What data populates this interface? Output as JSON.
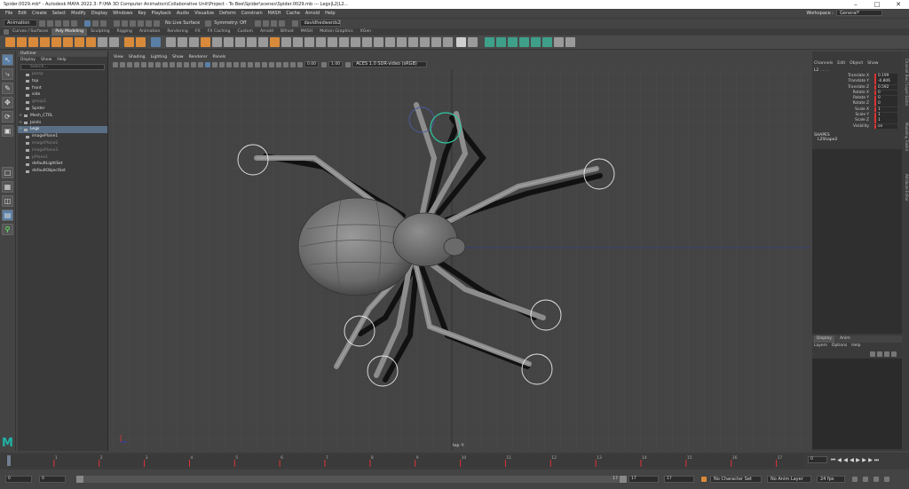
{
  "title_bar": {
    "text": "Spider.0029.mb* - Autodesk MAYA 2022.3: F:\\MA 3D Computer Animation\\Collaborative Unit\\Project - To Bee\\Spider\\scenes\\Spider.0029.mb --- Legs|L2|L2..."
  },
  "menu_bar": {
    "items": [
      "File",
      "Edit",
      "Create",
      "Select",
      "Modify",
      "Display",
      "Windows",
      "Key",
      "Playback",
      "Audio",
      "Visualize",
      "Deform",
      "Constrain",
      "MASH",
      "Cache",
      "Arnold",
      "Help"
    ],
    "workspace_label": "Workspace :",
    "workspace_value": "General*"
  },
  "status_line": {
    "mode": "Animation",
    "live_surface": "No Live Surface",
    "symmetry": "Symmetry: Off",
    "user": "davidhedwards2"
  },
  "shelf": {
    "tabs": [
      "Curves / Surfaces",
      "Poly Modeling",
      "Sculpting",
      "Rigging",
      "Animation",
      "Rendering",
      "FX",
      "FX Caching",
      "Custom",
      "Arnold",
      "Bifrost",
      "MASH",
      "Motion Graphics",
      "XGen"
    ],
    "active_tab": "Poly Modeling"
  },
  "toolbox": {
    "tools": [
      "select-tool",
      "lasso-tool",
      "paint-select-tool",
      "move-tool",
      "rotate-tool",
      "scale-tool"
    ]
  },
  "outliner": {
    "title": "Outliner",
    "menus": [
      "Display",
      "Show",
      "Help"
    ],
    "search_placeholder": "Search...",
    "items": [
      {
        "label": "persp",
        "dim": true,
        "indent": 1
      },
      {
        "label": "top",
        "dim": false,
        "indent": 1
      },
      {
        "label": "front",
        "dim": false,
        "indent": 1
      },
      {
        "label": "side",
        "dim": false,
        "indent": 1
      },
      {
        "label": "group1",
        "dim": true,
        "indent": 1
      },
      {
        "label": "Spider",
        "dim": false,
        "indent": 1
      },
      {
        "label": "Mesh_CTRL",
        "dim": false,
        "indent": 0,
        "expand": true
      },
      {
        "label": "Joints",
        "dim": false,
        "indent": 0,
        "expand": true
      },
      {
        "label": "Legs",
        "dim": false,
        "indent": 0,
        "expand": true,
        "selected": true
      },
      {
        "label": "imagePlane1",
        "dim": false,
        "indent": 1
      },
      {
        "label": "imagePlane2",
        "dim": true,
        "indent": 1
      },
      {
        "label": "imagePlane3",
        "dim": true,
        "indent": 1
      },
      {
        "label": "pPlane1",
        "dim": true,
        "indent": 1
      },
      {
        "label": "defaultLightSet",
        "dim": false,
        "indent": 1
      },
      {
        "label": "defaultObjectSet",
        "dim": false,
        "indent": 1
      }
    ]
  },
  "viewport": {
    "menus": [
      "View",
      "Shading",
      "Lighting",
      "Show",
      "Renderer",
      "Panels"
    ],
    "field_a": "0.00",
    "field_b": "1.00",
    "color_space": "ACES 1.0 SDR-video (sRGB)",
    "camera_label": "top -Y"
  },
  "channel_box": {
    "menus": [
      "Channels",
      "Edit",
      "Object",
      "Show"
    ],
    "object_name": "L2 . . . .",
    "attributes": [
      {
        "name": "Translate X",
        "value": "0.199"
      },
      {
        "name": "Translate Y",
        "value": "-0.806"
      },
      {
        "name": "Translate Z",
        "value": "0.592"
      },
      {
        "name": "Rotate X",
        "value": "0"
      },
      {
        "name": "Rotate Y",
        "value": "0"
      },
      {
        "name": "Rotate Z",
        "value": "0"
      },
      {
        "name": "Scale X",
        "value": "1"
      },
      {
        "name": "Scale Y",
        "value": "1"
      },
      {
        "name": "Scale Z",
        "value": "1"
      },
      {
        "name": "Visibility",
        "value": "on"
      }
    ],
    "shapes_header": "SHAPES",
    "shape_name": "L2Shape2"
  },
  "side_tabs": [
    "Channel Box / Layer Editor",
    "Modeling Toolkit",
    "Attribute Editor"
  ],
  "layer_editor": {
    "tabs": [
      "Display",
      "Anim"
    ],
    "menus": [
      "Layers",
      "Options",
      "Help"
    ]
  },
  "time_slider": {
    "ticks": [
      "1",
      "2",
      "3",
      "4",
      "5",
      "6",
      "7",
      "8",
      "9",
      "10",
      "11",
      "12",
      "13",
      "14",
      "15",
      "16",
      "17"
    ],
    "current_frame": "0"
  },
  "range_bar": {
    "start": "0",
    "start_inner": "0",
    "end_inner": "17",
    "end": "17",
    "end_a": "17",
    "end_b": "17",
    "character_set": "No Character Set",
    "anim_layer": "No Anim Layer",
    "fps": "24 fps"
  },
  "colors": {
    "accent_orange": "#d88a3a",
    "selection_blue": "#5a7fa6",
    "keyframe_red": "#d33",
    "maya_logo": "#1fb5a8"
  }
}
